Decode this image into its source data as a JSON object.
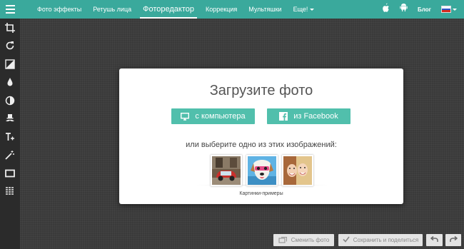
{
  "topbar": {
    "nav": [
      {
        "label": "Фото эффекты"
      },
      {
        "label": "Ретушь лица"
      },
      {
        "label": "Фоторедактор"
      },
      {
        "label": "Коррекция"
      },
      {
        "label": "Мультяшки"
      },
      {
        "label": "Еще!"
      }
    ],
    "blog_label": "Блог",
    "accent_color": "#3aa99c"
  },
  "sidebar": {
    "tools": [
      "crop-icon",
      "rotate-icon",
      "exposure-icon",
      "drop-icon",
      "contrast-icon",
      "mustache-icon",
      "text-icon",
      "magic-wand-icon",
      "frame-icon",
      "texture-icon"
    ]
  },
  "dialog": {
    "title": "Загрузите фото",
    "btn_computer": "с компьютера",
    "btn_facebook": "из Facebook",
    "choose_text": "или выберите одно из этих изображений:",
    "samples_caption": "Картинки-примеры",
    "button_color": "#51bfac"
  },
  "bottom": {
    "change_photo": "Сменить фото",
    "save_share": "Сохранить и поделиться"
  }
}
